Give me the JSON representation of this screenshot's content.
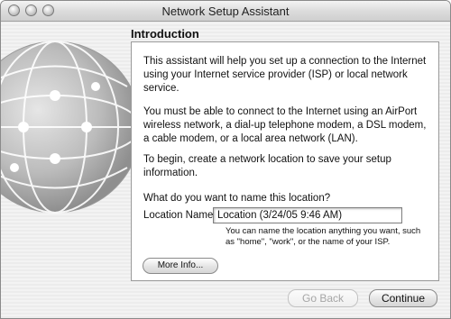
{
  "window": {
    "title": "Network Setup Assistant"
  },
  "section": {
    "heading": "Introduction"
  },
  "intro": {
    "p1": "This assistant will help you set up a connection to the Internet using your Internet service provider (ISP) or local network service.",
    "p2": "You must be able to connect to the Internet using an AirPort wireless network, a dial-up telephone modem, a DSL modem, a cable modem, or a local area network (LAN).",
    "p3": "To begin, create a network location to save your setup information."
  },
  "location": {
    "question": "What do you want to name this location?",
    "label": "Location Name:",
    "value": "Location (3/24/05 9:46 AM)",
    "hint": "You can name the location anything you want, such as \"home\", \"work\", or the name of your ISP."
  },
  "buttons": {
    "more_info": "More Info...",
    "go_back": "Go Back",
    "continue": "Continue"
  },
  "icons": {
    "globe": "network-globe-icon"
  },
  "colors": {
    "panel_bg": "#ffffff",
    "window_bg": "#f0f0f0",
    "disabled_text": "#a6a6a6"
  }
}
